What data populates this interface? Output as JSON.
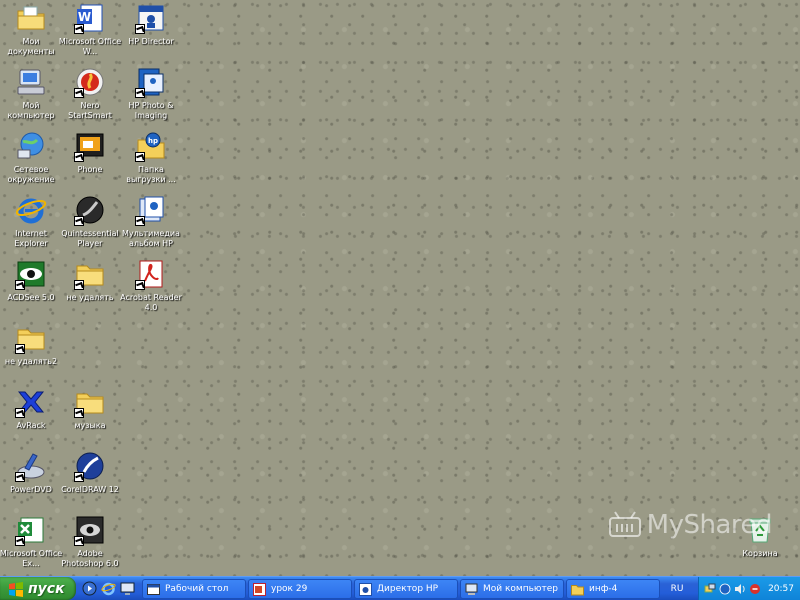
{
  "desktop": {
    "icons": [
      {
        "label": "Мои документы",
        "icon": "my-documents-icon",
        "shortcut": false
      },
      {
        "label": "Microsoft Office W...",
        "icon": "word-icon",
        "shortcut": true
      },
      {
        "label": "HP Director",
        "icon": "hp-director-icon",
        "shortcut": true
      },
      {
        "label": "Мой компьютер",
        "icon": "my-computer-icon",
        "shortcut": false
      },
      {
        "label": "Nero StartSmart",
        "icon": "nero-icon",
        "shortcut": true
      },
      {
        "label": "HP Photo & Imaging",
        "icon": "hp-photo-icon",
        "shortcut": true
      },
      {
        "label": "Сетевое окружение",
        "icon": "network-icon",
        "shortcut": false
      },
      {
        "label": "Phone",
        "icon": "phone-icon",
        "shortcut": true
      },
      {
        "label": "Папка выгрузки ...",
        "icon": "hp-folder-icon",
        "shortcut": true
      },
      {
        "label": "Internet Explorer",
        "icon": "ie-icon",
        "shortcut": false
      },
      {
        "label": "Quintessential Player",
        "icon": "qplayer-icon",
        "shortcut": true
      },
      {
        "label": "Мультимедиа альбом HP",
        "icon": "hp-album-icon",
        "shortcut": true
      },
      {
        "label": "ACDSee 5.0",
        "icon": "acdsee-icon",
        "shortcut": true
      },
      {
        "label": "не удалять",
        "icon": "folder-icon",
        "shortcut": true
      },
      {
        "label": "Acrobat Reader 4.0",
        "icon": "acrobat-icon",
        "shortcut": true
      },
      {
        "label": "не удалять2",
        "icon": "folder-icon",
        "shortcut": true
      },
      {
        "label": "AvRack",
        "icon": "avrack-icon",
        "shortcut": true
      },
      {
        "label": "музыка",
        "icon": "folder-icon",
        "shortcut": true
      },
      {
        "label": "PowerDVD",
        "icon": "powerdvd-icon",
        "shortcut": true
      },
      {
        "label": "CorelDRAW 12",
        "icon": "coreldraw-icon",
        "shortcut": true
      },
      {
        "label": "Microsoft Office Ex...",
        "icon": "excel-icon",
        "shortcut": true
      },
      {
        "label": "Adobe Photoshop 6.0",
        "icon": "photoshop-icon",
        "shortcut": true
      },
      {
        "label": "Корзина",
        "icon": "recycle-bin-icon",
        "shortcut": false
      }
    ]
  },
  "watermark": {
    "text": "MyShared"
  },
  "taskbar": {
    "start_label": "пуск",
    "tasks": [
      {
        "label": "Рабочий стол",
        "icon": "desktop-window-icon"
      },
      {
        "label": "урок 29",
        "icon": "powerpoint-icon"
      },
      {
        "label": "Директор HP",
        "icon": "hp-director-icon"
      },
      {
        "label": "Мой компьютер",
        "icon": "my-computer-icon"
      },
      {
        "label": "инф-4",
        "icon": "folder-icon"
      }
    ],
    "lang": "RU",
    "clock": "20:57"
  },
  "colors": {
    "taskbar": "#245ed9",
    "start": "#3c9b3c",
    "tray": "#0f84d8",
    "desktop": "#9a9a86"
  }
}
